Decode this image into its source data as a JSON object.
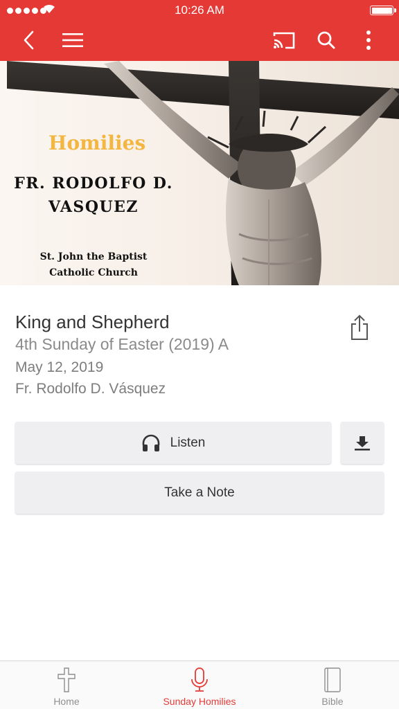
{
  "status_bar": {
    "time": "10:26 AM"
  },
  "colors": {
    "brand": "#e53935",
    "tab_active": "#e53935",
    "tab_inactive": "#8e8e8e"
  },
  "toolbar": {
    "icons": [
      "back-arrow-icon",
      "menu-icon",
      "cast-icon",
      "search-icon",
      "more-vertical-icon"
    ]
  },
  "hero": {
    "title": "Homilies",
    "name_line1": "FR. RODOLFO D.",
    "name_line2": "VASQUEZ",
    "church_line1": "St. John the Baptist",
    "church_line2": "Catholic Church"
  },
  "homily": {
    "title": "King and Shepherd",
    "subtitle": "4th Sunday of Easter (2019) A",
    "date": "May 12, 2019",
    "author": "Fr. Rodolfo D. Vásquez"
  },
  "actions": {
    "listen_label": "Listen",
    "take_note_label": "Take a Note",
    "icons": [
      "headphones-icon",
      "download-icon",
      "share-icon"
    ]
  },
  "tabs": [
    {
      "label": "Home",
      "icon": "cross-icon",
      "active": false
    },
    {
      "label": "Sunday Homilies",
      "icon": "microphone-icon",
      "active": true
    },
    {
      "label": "Bible",
      "icon": "book-icon",
      "active": false
    }
  ]
}
